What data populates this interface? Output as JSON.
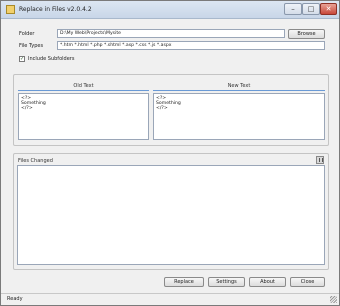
{
  "window": {
    "title": "Replace in Files v2.0.4.2",
    "minimize_glyph": "–",
    "maximize_glyph": "□",
    "close_glyph": "✕"
  },
  "form": {
    "folder_label": "Folder",
    "folder_value": "D:\\My Web\\Projects\\Mysite",
    "browse_label": "Browse",
    "filetypes_label": "File Types",
    "filetypes_value": "*.htm *.html *.php *.shtml *.asp *.css *.js *.aspx",
    "include_subfolders_label": "Include Subfolders",
    "include_subfolders_checked": true
  },
  "text_panels": {
    "old_header": "Old Text",
    "new_header": "New Text",
    "old_lines": "<?>\nSomething\n</?>",
    "new_lines": "<?>\nSomething\n</?>"
  },
  "log": {
    "label": "Files Changed"
  },
  "buttons": {
    "replace": "Replace",
    "settings": "Settings",
    "about": "About",
    "close": "Close"
  },
  "status": {
    "text": "Ready"
  }
}
